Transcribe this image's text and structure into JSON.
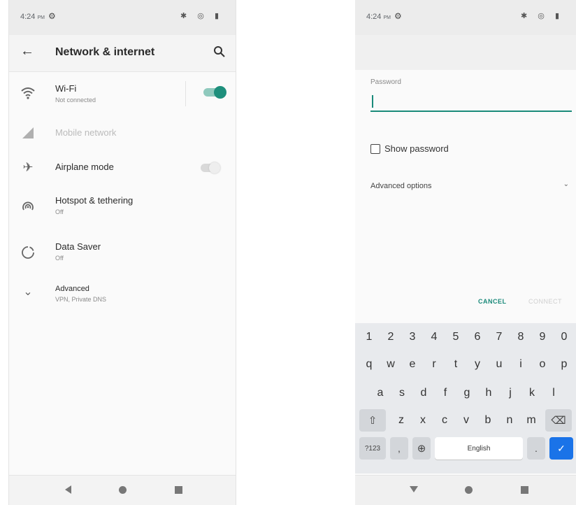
{
  "left_screen": {
    "status": {
      "time": "4:24",
      "ampm": "PM",
      "gear": "⚙",
      "sys_icons": "✱ ◎ ▮"
    },
    "appbar": {
      "back": "←",
      "title": "Network & internet"
    },
    "items": [
      {
        "title": "Wi-Fi",
        "subtitle": "Not connected",
        "icon": "wifi-icon",
        "toggle": true
      },
      {
        "title": "Mobile network",
        "subtitle": "",
        "icon": "signal-icon",
        "disabled": true
      },
      {
        "title": "Airplane mode",
        "subtitle": "",
        "icon": "airplane-icon",
        "toggle": false
      },
      {
        "title": "Hotspot & tethering",
        "subtitle": "Off",
        "icon": "hotspot-icon"
      },
      {
        "title": "Data Saver",
        "subtitle": "Off",
        "icon": "data-saver-icon"
      },
      {
        "title": "Advanced",
        "subtitle": "VPN, Private DNS",
        "icon": "chevron-down-icon"
      }
    ],
    "icon_glyphs": {
      "airplane": "✈",
      "chevron": "⌄"
    }
  },
  "right_screen": {
    "status": {
      "time": "4:24",
      "ampm": "PM",
      "gear": "⚙",
      "sys_icons": "✱ ◎ ▮"
    },
    "password_label": "Password",
    "password_value": "",
    "show_password_label": "Show password",
    "show_password_checked": false,
    "advanced_options_label": "Advanced options",
    "advanced_chevron": "⌄",
    "cancel_label": "CANCEL",
    "connect_label": "CONNECT",
    "keyboard": {
      "digits": [
        "1",
        "2",
        "3",
        "4",
        "5",
        "6",
        "7",
        "8",
        "9",
        "0"
      ],
      "row1": [
        "q",
        "w",
        "e",
        "r",
        "t",
        "y",
        "u",
        "i",
        "o",
        "p"
      ],
      "row2": [
        "a",
        "s",
        "d",
        "f",
        "g",
        "h",
        "j",
        "k",
        "l"
      ],
      "row3": [
        "z",
        "x",
        "c",
        "v",
        "b",
        "n",
        "m"
      ],
      "shift": "⇧",
      "backspace": "⌫",
      "symbols": "?123",
      "comma": ",",
      "globe": "⊕",
      "space": "English",
      "period": ".",
      "enter": "✓"
    }
  },
  "colors": {
    "accent": "#1a8a7a",
    "enter_key": "#1a73e8"
  }
}
